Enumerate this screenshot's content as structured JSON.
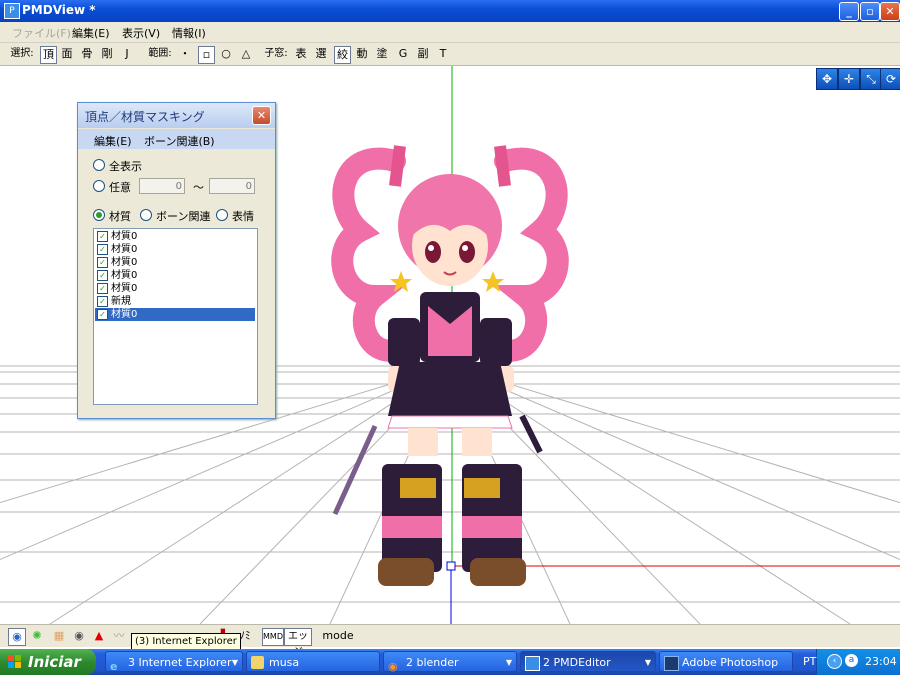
{
  "window": {
    "title": "PMDView *"
  },
  "menubar": {
    "items": [
      "ファイル(F)",
      "編集(E)",
      "表示(V)",
      "情報(I)"
    ]
  },
  "toolbar": {
    "select_label": "選択:",
    "select_items": [
      "頂",
      "面",
      "骨",
      "剛",
      "J"
    ],
    "range_label": "範囲:",
    "range_items": [
      "・",
      "▫",
      "○",
      "△"
    ],
    "child_label": "子窓:",
    "child_items": [
      "表",
      "選",
      "絞",
      "動",
      "塗",
      "G",
      "副",
      "T"
    ]
  },
  "mask_window": {
    "title": "頂点／材質マスキング",
    "menu": [
      "編集(E)",
      "ボーン関連(B)"
    ],
    "radio_all": "全表示",
    "radio_any": "任意",
    "range_from": "0",
    "range_sep": "〜",
    "range_to": "0",
    "radio_material": "材質",
    "radio_bone": "ボーン関連",
    "radio_expression": "表情",
    "list": [
      "材質0",
      "材質0",
      "材質0",
      "材質0",
      "材質0",
      "新規",
      "材質0"
    ]
  },
  "bottombar": {
    "mmd_label": "MMD",
    "edge_label": "エッジ",
    "mode_label": "mode ▾",
    "mi_label": "ﾉﾐ"
  },
  "tooltip": "(3) Internet Explorer",
  "taskbar": {
    "start_label": "Iniciar",
    "tasks": [
      "3 Internet Explorer",
      "musa",
      "2 blender",
      "2 PMDEditor",
      "Adobe Photoshop"
    ],
    "lang": "PT",
    "clock": "23:04"
  },
  "colors": {
    "title_blue": "#0a4fd6",
    "grid": "#b4b4b4",
    "axis_green": "#00b000",
    "axis_red": "#e00000",
    "axis_blue": "#0000e0"
  }
}
